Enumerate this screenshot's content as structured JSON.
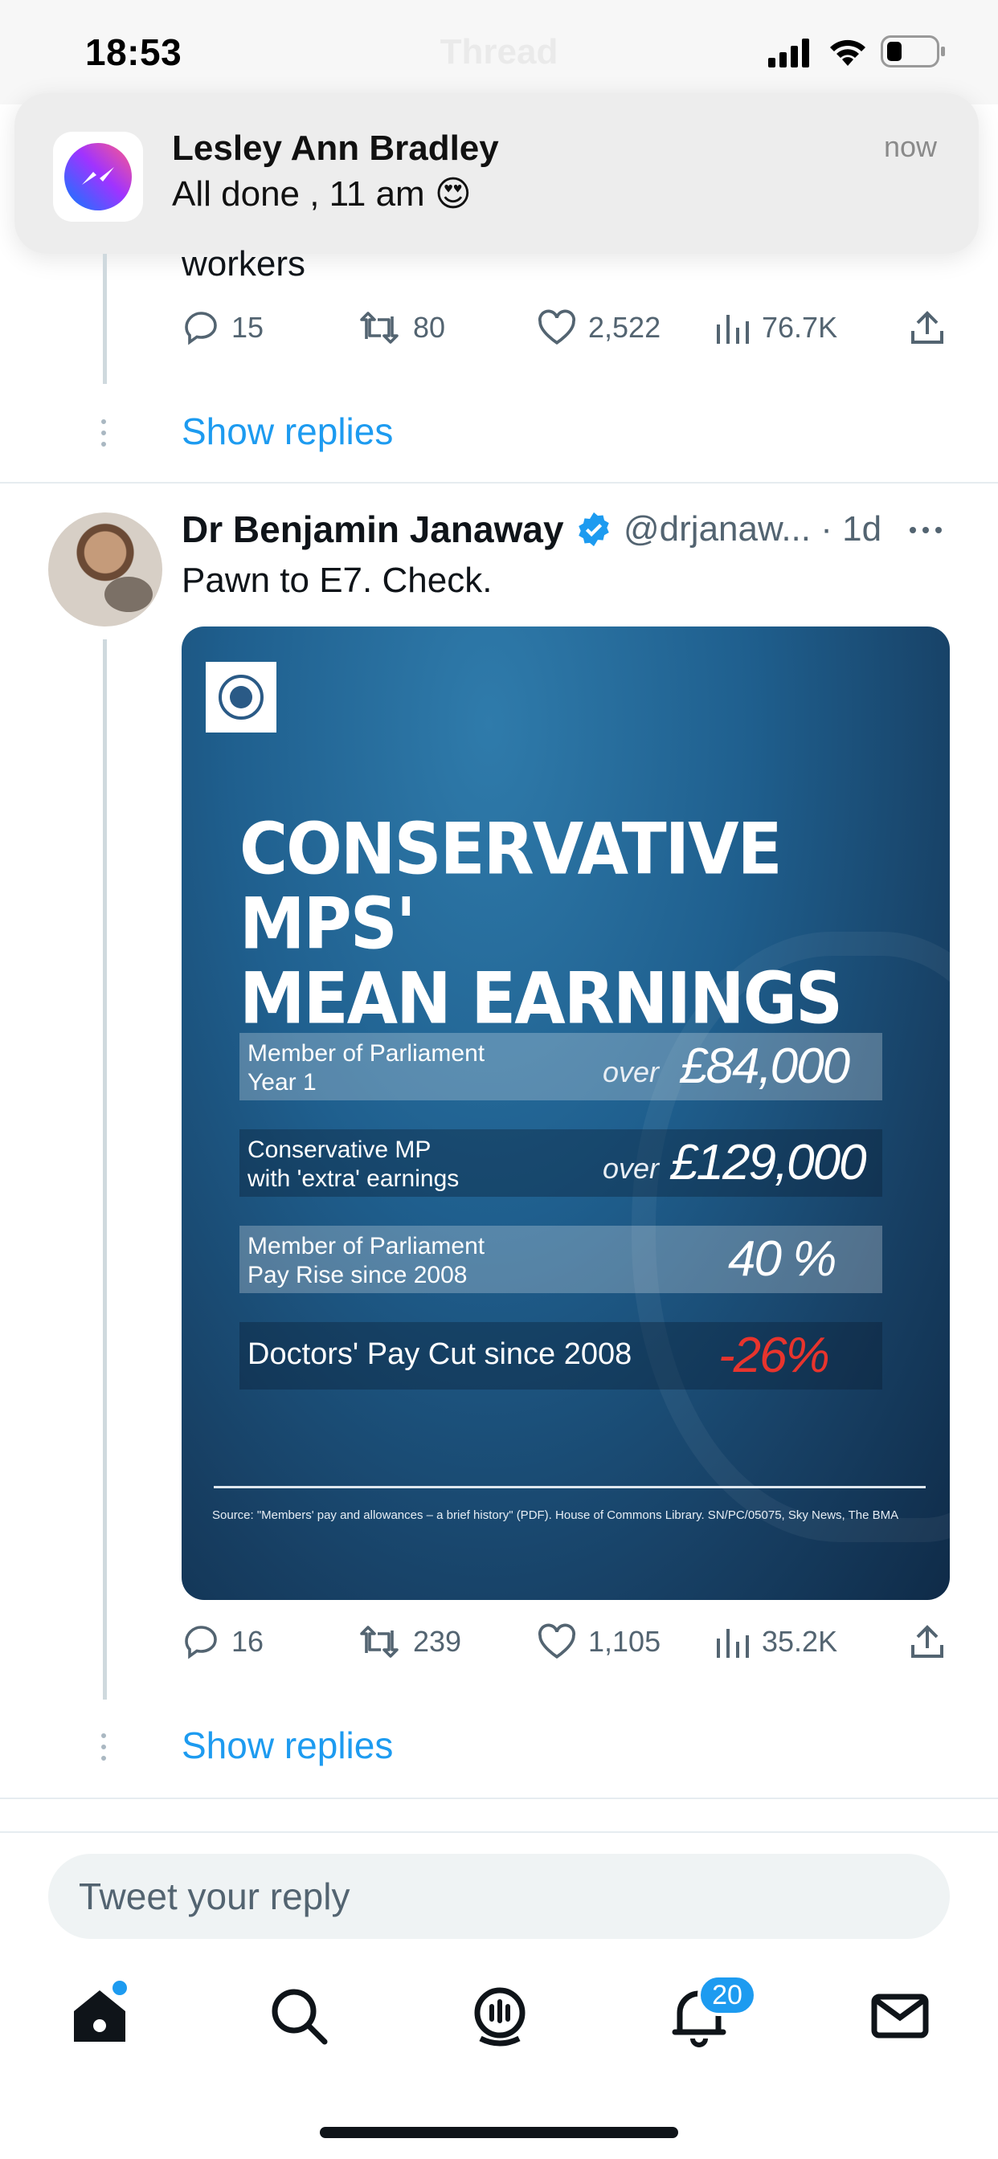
{
  "status_bar": {
    "time": "18:53",
    "header_title": "Thread"
  },
  "notification": {
    "app_icon": "messenger-icon",
    "sender": "Lesley Ann Bradley",
    "message": "All done , 11 am 😍",
    "time": "now"
  },
  "previous_tweet": {
    "text_tail": "workers",
    "replies": "15",
    "retweets": "80",
    "likes": "2,522",
    "views": "76.7K",
    "show_replies": "Show replies"
  },
  "tweet": {
    "author_name": "Dr Benjamin Janaway",
    "handle": "@drjanaw...",
    "separator": "·",
    "age": "1d",
    "text": "Pawn to E7. Check.",
    "media": {
      "title_line1": "CONSERVATIVE MPS'",
      "title_line2": "MEAN EARNINGS",
      "rows": [
        {
          "label_line1": "Member of Parliament",
          "label_line2": "Year 1",
          "prefix": "over",
          "value": "£84,000"
        },
        {
          "label_line1": "Conservative MP",
          "label_line2": "with 'extra' earnings",
          "prefix": "over",
          "value": "£129,000"
        },
        {
          "label_line1": "Member of Parliament",
          "label_line2": "Pay Rise since 2008",
          "prefix": "",
          "value": "40 %"
        },
        {
          "label_line1": "Doctors' Pay Cut since 2008",
          "label_line2": "",
          "prefix": "",
          "value": "-26%"
        }
      ],
      "source": "Source: \"Members' pay and allowances – a brief history\" (PDF). House of Commons Library. SN/PC/05075, Sky News, The BMA"
    },
    "replies": "16",
    "retweets": "239",
    "likes": "1,105",
    "views": "35.2K",
    "show_replies": "Show replies"
  },
  "reply_box": {
    "placeholder": "Tweet your reply"
  },
  "tab_bar": {
    "notifications_badge": "20"
  },
  "colors": {
    "accent": "#1d9bf0",
    "negative": "#e8342d",
    "muted": "#536471"
  }
}
